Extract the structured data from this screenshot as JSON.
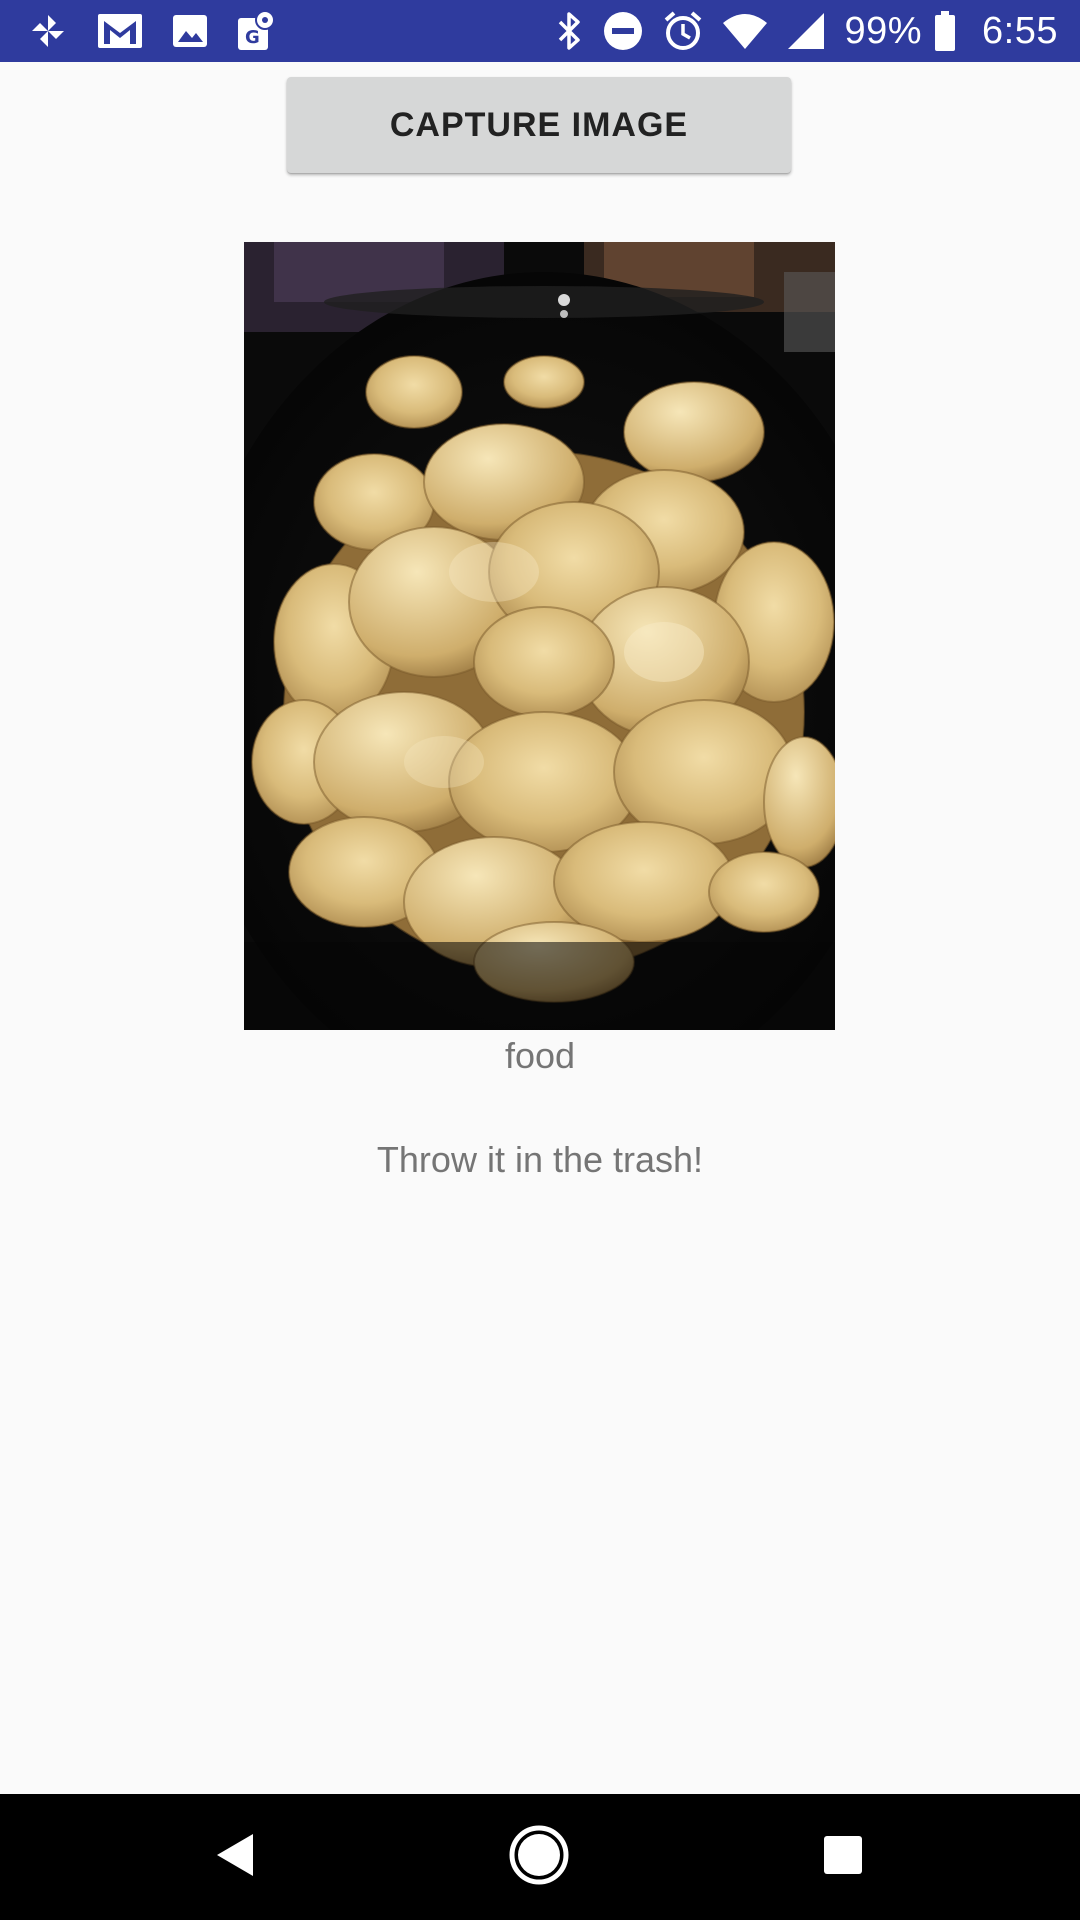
{
  "status_bar": {
    "notification_icons": [
      "pinwheel-icon",
      "gmail-icon",
      "gallery-icon",
      "maps-icon"
    ],
    "system_icons": [
      "bluetooth-icon",
      "do-not-disturb-icon",
      "alarm-icon",
      "wifi-icon",
      "cellular-signal-icon"
    ],
    "battery_percent": "99%",
    "time": "6:55",
    "background_color": "#2f3b9e"
  },
  "main": {
    "capture_button_label": "CAPTURE IMAGE",
    "photo": {
      "subject": "potato chips on a black plate"
    },
    "prediction_label": "food",
    "advice_label": "Throw it in the trash!"
  },
  "nav_bar": {
    "buttons": [
      "back-icon",
      "home-icon",
      "recents-icon"
    ],
    "background_color": "#000000"
  }
}
